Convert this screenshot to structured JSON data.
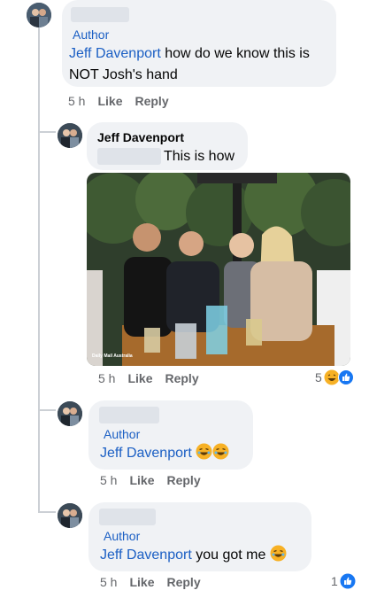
{
  "comment_top": {
    "badge": "Author",
    "mention": "Jeff Davenport",
    "text_line1": " how do we know this is",
    "text_line2": "NOT Josh's hand",
    "time": "5 h",
    "like": "Like",
    "reply": "Reply"
  },
  "reply_1": {
    "author": "Jeff Davenport",
    "text": "This is how",
    "photo_watermark": "Daily Mail Australia",
    "time": "5 h",
    "like": "Like",
    "reply": "Reply",
    "reaction_count": "5",
    "reaction_icons": [
      "laugh-react-icon",
      "like-react-icon"
    ]
  },
  "reply_2": {
    "badge": "Author",
    "mention": "Jeff Davenport",
    "emojis": [
      "laughing-emoji",
      "laughing-emoji"
    ],
    "time": "5 h",
    "like": "Like",
    "reply": "Reply"
  },
  "reply_3": {
    "badge": "Author",
    "mention": "Jeff Davenport",
    "text": " you got me ",
    "emojis": [
      "laughing-emoji"
    ],
    "time": "5 h",
    "like": "Like",
    "reply": "Reply",
    "reaction_count": "1",
    "reaction_icons": [
      "like-react-icon"
    ]
  },
  "colors": {
    "link_blue": "#1b5fc4",
    "bubble_bg": "#f0f2f5",
    "meta_gray": "#65676b",
    "like_blue": "#1877f2"
  }
}
